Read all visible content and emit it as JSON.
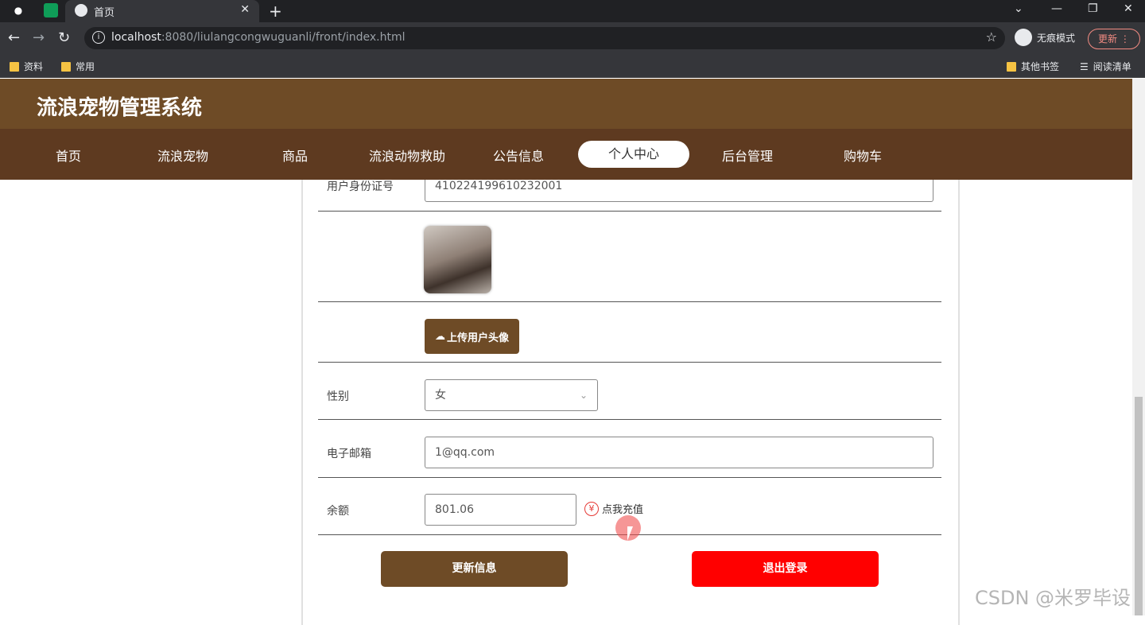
{
  "browser": {
    "tab_title": "首页",
    "url_host": "localhost",
    "url_rest": ":8080/liulangcongwuguanli/front/index.html",
    "incognito_label": "无痕模式",
    "update_label": "更新",
    "bookmarks": [
      "资料",
      "常用"
    ],
    "other_bookmarks": "其他书签",
    "reading_list": "阅读清单"
  },
  "site": {
    "title": "流浪宠物管理系统",
    "nav": [
      "首页",
      "流浪宠物",
      "商品",
      "流浪动物救助",
      "公告信息",
      "个人中心",
      "后台管理",
      "购物车"
    ],
    "active_nav": "个人中心"
  },
  "form": {
    "id_label": "用户身份证号",
    "id_value": "410224199610232001",
    "upload_label": "上传用户头像",
    "gender_label": "性别",
    "gender_value": "女",
    "email_label": "电子邮箱",
    "email_value": "1@qq.com",
    "balance_label": "余额",
    "balance_value": "801.06",
    "recharge_label": "点我充值",
    "yen_symbol": "¥",
    "update_button": "更新信息",
    "logout_button": "退出登录"
  },
  "watermark": "CSDN @米罗毕设",
  "colors": {
    "header": "#6e4b26",
    "nav": "#5e3a20",
    "logout": "#ff0000"
  }
}
